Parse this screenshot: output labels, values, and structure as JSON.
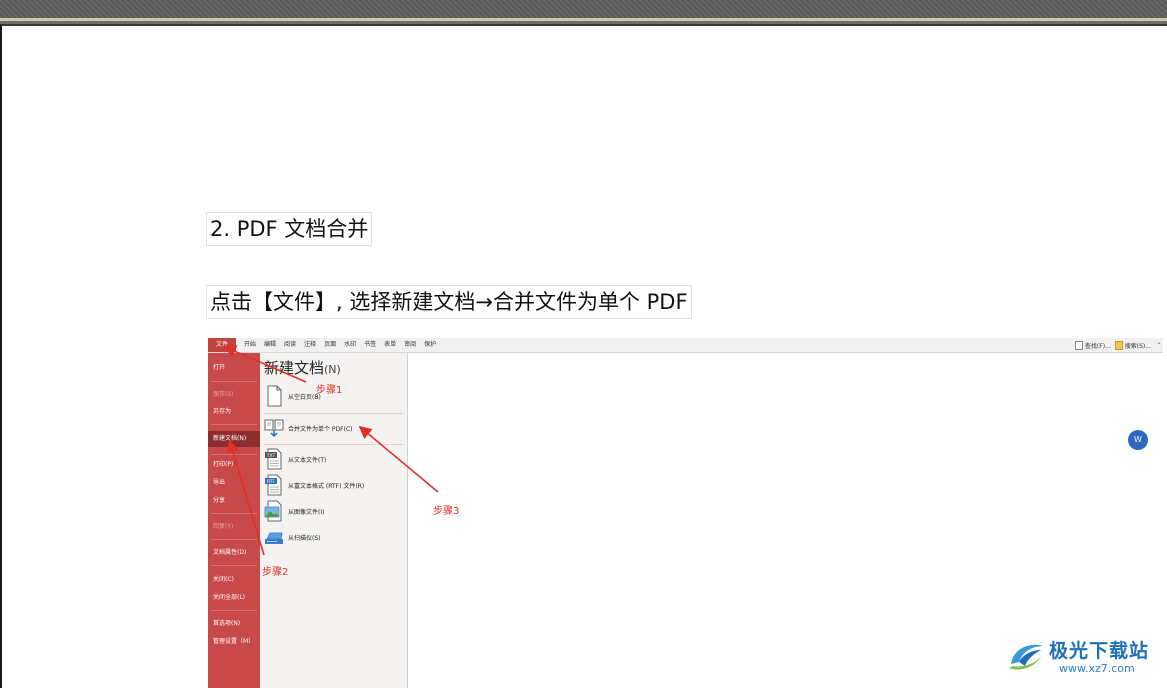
{
  "document": {
    "heading": "2.  PDF 文档合并",
    "instruction": "点击【文件】, 选择新建文档→合并文件为单个 PDF"
  },
  "app": {
    "file_tab": "文件",
    "tabs": [
      "开始",
      "编辑",
      "阅读",
      "注释",
      "页面",
      "水印",
      "书签",
      "表单",
      "审阅",
      "保护"
    ],
    "find_label": "查找(F)...",
    "search_label": "搜索(S)...",
    "sidebar": [
      {
        "label": "打开",
        "state": "normal"
      },
      {
        "label": "保存(S)",
        "state": "disabled"
      },
      {
        "label": "另存为",
        "state": "normal"
      },
      {
        "label": "新建文档(N)",
        "state": "selected"
      },
      {
        "label": "打印(P)",
        "state": "normal"
      },
      {
        "label": "导出",
        "state": "normal"
      },
      {
        "label": "分享",
        "state": "normal"
      },
      {
        "label": "回复(Y)",
        "state": "disabled"
      },
      {
        "label": "文档属性(D)",
        "state": "normal"
      },
      {
        "label": "关闭(C)",
        "state": "normal"
      },
      {
        "label": "关闭全部(L)",
        "state": "normal"
      },
      {
        "label": "首选项(N)",
        "state": "normal"
      },
      {
        "label": "管理设置（M）",
        "state": "normal"
      }
    ],
    "panel_title": "新建文档",
    "panel_title_suffix": "(N)",
    "options": {
      "blank": "从空白页(B)",
      "merge": "合并文件为单个 PDF(C)",
      "text": "从文本文件(T)",
      "rtf": "从富文本格式 (RTF) 文件(R)",
      "image": "从图像文件(I)",
      "scanner": "从扫描仪(S)"
    }
  },
  "steps": {
    "step1": "步骤1",
    "step2": "步骤2",
    "step3": "步骤3"
  },
  "watermark": {
    "name": "极光下载站",
    "url": "www.xz7.com"
  },
  "colors": {
    "sidebar": "#c8494a",
    "sidebar_selected": "#8f2c2d",
    "annotation": "#e0302a",
    "watermark": "#1d6fb8"
  }
}
